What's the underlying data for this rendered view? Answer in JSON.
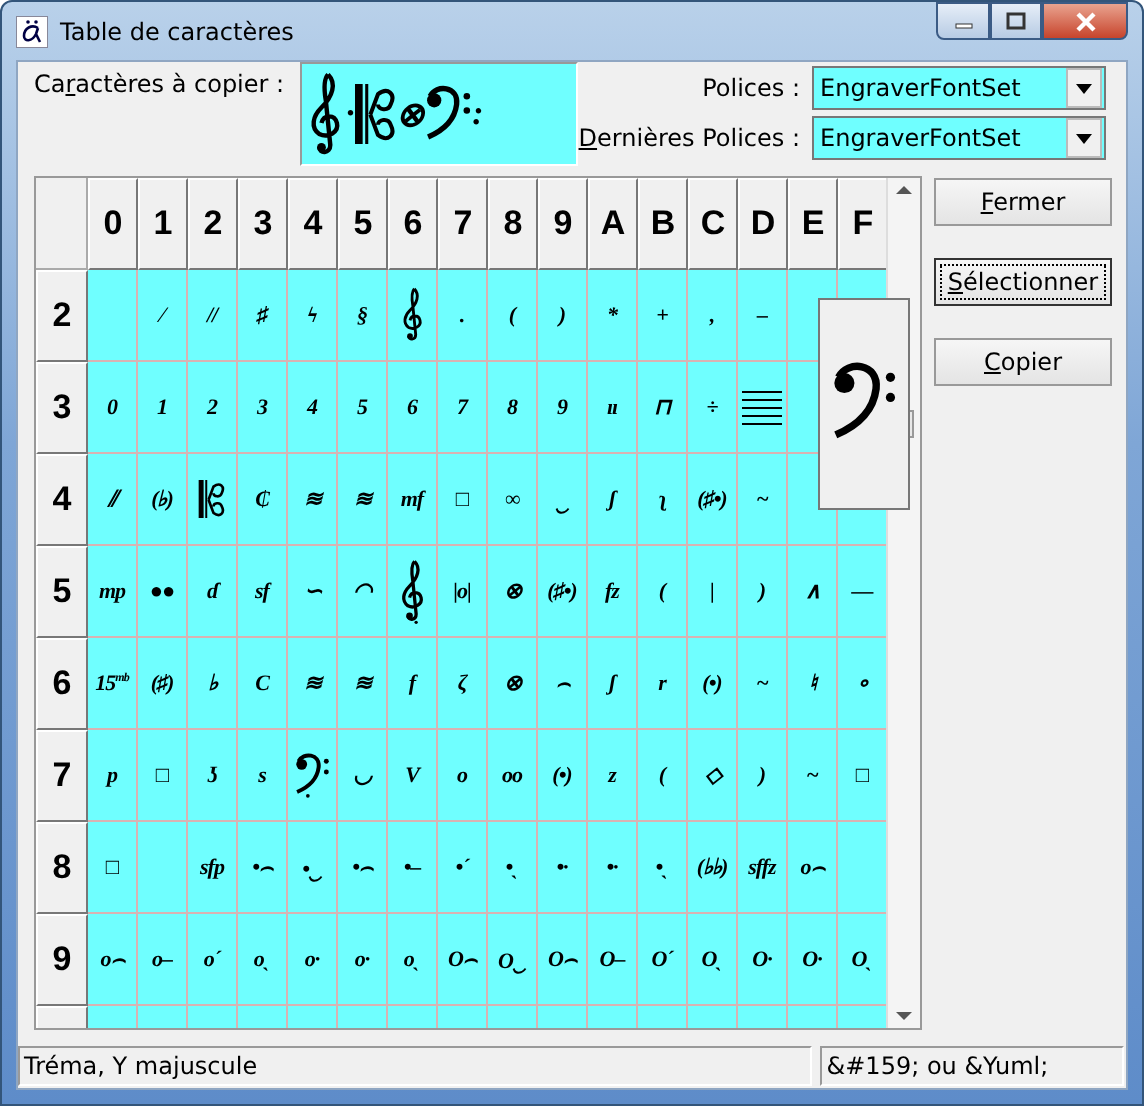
{
  "window": {
    "title": "Table de caractères"
  },
  "copy": {
    "label": {
      "before": "Ca",
      "key": "r",
      "after": "actères à copier :"
    },
    "items": [
      {
        "kind": "treble-clef"
      },
      {
        "kind": "text",
        "text": "·"
      },
      {
        "kind": "alto-clef"
      },
      {
        "kind": "text",
        "text": "⊗"
      },
      {
        "kind": "bass-clef"
      },
      {
        "kind": "text",
        "text": ":"
      }
    ]
  },
  "fonts": [
    {
      "label": {
        "before": "Polices :"
      },
      "value": "EngraverFontSet"
    },
    {
      "label": {
        "key": "D",
        "after": "ernières Polices :"
      },
      "value": "EngraverFontSet"
    }
  ],
  "table": {
    "columns": [
      "0",
      "1",
      "2",
      "3",
      "4",
      "5",
      "6",
      "7",
      "8",
      "9",
      "A",
      "B",
      "C",
      "D",
      "E",
      "F"
    ],
    "rows": [
      {
        "label": "2",
        "cells": [
          {
            "kind": "empty"
          },
          {
            "kind": "text",
            "text": "⁄"
          },
          {
            "kind": "text",
            "text": "//"
          },
          {
            "kind": "text",
            "text": "♯"
          },
          {
            "kind": "text",
            "text": "ϟ"
          },
          {
            "kind": "text",
            "text": "§"
          },
          {
            "kind": "treble-clef"
          },
          {
            "kind": "text",
            "text": "."
          },
          {
            "kind": "text",
            "text": "("
          },
          {
            "kind": "text",
            "text": ")"
          },
          {
            "kind": "text",
            "text": "*"
          },
          {
            "kind": "text",
            "text": "+"
          },
          {
            "kind": "text",
            "text": ","
          },
          {
            "kind": "text",
            "text": "–"
          },
          {
            "kind": "empty"
          },
          {
            "kind": "empty"
          }
        ]
      },
      {
        "label": "3",
        "cells": [
          {
            "kind": "text",
            "text": "0"
          },
          {
            "kind": "text",
            "text": "1"
          },
          {
            "kind": "text",
            "text": "2"
          },
          {
            "kind": "text",
            "text": "3"
          },
          {
            "kind": "text",
            "text": "4"
          },
          {
            "kind": "text",
            "text": "5"
          },
          {
            "kind": "text",
            "text": "6"
          },
          {
            "kind": "text",
            "text": "7"
          },
          {
            "kind": "text",
            "text": "8"
          },
          {
            "kind": "text",
            "text": "9"
          },
          {
            "kind": "text",
            "text": "ıı"
          },
          {
            "kind": "text",
            "text": "⊓"
          },
          {
            "kind": "text",
            "text": "÷"
          },
          {
            "kind": "staff"
          },
          {
            "kind": "empty"
          },
          {
            "kind": "covered"
          }
        ]
      },
      {
        "label": "4",
        "cells": [
          {
            "kind": "text",
            "text": "⫽"
          },
          {
            "kind": "text",
            "text": "(♭)"
          },
          {
            "kind": "alto-clef"
          },
          {
            "kind": "text",
            "text": "₵"
          },
          {
            "kind": "text",
            "text": "≋"
          },
          {
            "kind": "text",
            "text": "≋"
          },
          {
            "kind": "text",
            "text": "mf"
          },
          {
            "kind": "text",
            "text": "□"
          },
          {
            "kind": "text",
            "text": "∞"
          },
          {
            "kind": "text",
            "text": "‿"
          },
          {
            "kind": "text",
            "text": "ʃ"
          },
          {
            "kind": "text",
            "text": "ʅ"
          },
          {
            "kind": "text",
            "text": "(♯•)"
          },
          {
            "kind": "text",
            "text": "~"
          },
          {
            "kind": "empty"
          },
          {
            "kind": "empty"
          }
        ]
      },
      {
        "label": "5",
        "cells": [
          {
            "kind": "text",
            "text": "mp"
          },
          {
            "kind": "text",
            "text": "●●"
          },
          {
            "kind": "text",
            "text": "ɗ"
          },
          {
            "kind": "text",
            "text": "sf"
          },
          {
            "kind": "text",
            "text": "∽"
          },
          {
            "kind": "text",
            "text": "◠"
          },
          {
            "kind": "treble-clef-8"
          },
          {
            "kind": "text",
            "text": "|o|"
          },
          {
            "kind": "text",
            "text": "⊗"
          },
          {
            "kind": "text",
            "text": "(♯•)"
          },
          {
            "kind": "text",
            "text": "fz"
          },
          {
            "kind": "text",
            "text": "("
          },
          {
            "kind": "text",
            "text": "|"
          },
          {
            "kind": "text",
            "text": ")"
          },
          {
            "kind": "text",
            "text": "∧"
          },
          {
            "kind": "text",
            "text": "—"
          }
        ]
      },
      {
        "label": "6",
        "cells": [
          {
            "kind": "text",
            "text": "15$^{mb}$"
          },
          {
            "kind": "text",
            "text": "(♯)"
          },
          {
            "kind": "text",
            "text": "♭"
          },
          {
            "kind": "text",
            "text": "C"
          },
          {
            "kind": "text",
            "text": "≋"
          },
          {
            "kind": "text",
            "text": "≋"
          },
          {
            "kind": "text",
            "text": "f"
          },
          {
            "kind": "text",
            "text": "ζ"
          },
          {
            "kind": "text",
            "text": "⊗"
          },
          {
            "kind": "text",
            "text": "⌢"
          },
          {
            "kind": "text",
            "text": "ʃ"
          },
          {
            "kind": "text",
            "text": "r"
          },
          {
            "kind": "text",
            "text": "(•)"
          },
          {
            "kind": "text",
            "text": "~"
          },
          {
            "kind": "text",
            "text": "♮"
          },
          {
            "kind": "text",
            "text": "∘"
          }
        ]
      },
      {
        "label": "7",
        "cells": [
          {
            "kind": "text",
            "text": "p"
          },
          {
            "kind": "text",
            "text": "□"
          },
          {
            "kind": "text",
            "text": "ʖ"
          },
          {
            "kind": "text",
            "text": "s"
          },
          {
            "kind": "bass-clef-8"
          },
          {
            "kind": "text",
            "text": "◡"
          },
          {
            "kind": "text",
            "text": "V"
          },
          {
            "kind": "text",
            "text": "o"
          },
          {
            "kind": "text",
            "text": "oo"
          },
          {
            "kind": "text",
            "text": "(•)"
          },
          {
            "kind": "text",
            "text": "z"
          },
          {
            "kind": "text",
            "text": "("
          },
          {
            "kind": "text",
            "text": "◇"
          },
          {
            "kind": "text",
            "text": ")"
          },
          {
            "kind": "text",
            "text": "~"
          },
          {
            "kind": "text",
            "text": "□"
          }
        ]
      },
      {
        "label": "8",
        "cells": [
          {
            "kind": "text",
            "text": "□"
          },
          {
            "kind": "empty"
          },
          {
            "kind": "text",
            "text": "sfp"
          },
          {
            "kind": "text",
            "text": "•⌢"
          },
          {
            "kind": "text",
            "text": "•‿"
          },
          {
            "kind": "text",
            "text": "•⌢"
          },
          {
            "kind": "text",
            "text": "•–"
          },
          {
            "kind": "text",
            "text": "•´"
          },
          {
            "kind": "text",
            "text": "•ˎ"
          },
          {
            "kind": "text",
            "text": "•·"
          },
          {
            "kind": "text",
            "text": "•·"
          },
          {
            "kind": "text",
            "text": "•ˎ"
          },
          {
            "kind": "text",
            "text": "(♭♭)"
          },
          {
            "kind": "text",
            "text": "sffz"
          },
          {
            "kind": "text",
            "text": "o⌢"
          },
          {
            "kind": "empty"
          }
        ]
      },
      {
        "label": "9",
        "cells": [
          {
            "kind": "text",
            "text": "o⌢"
          },
          {
            "kind": "text",
            "text": "o–"
          },
          {
            "kind": "text",
            "text": "o´"
          },
          {
            "kind": "text",
            "text": "oˎ"
          },
          {
            "kind": "text",
            "text": "o·"
          },
          {
            "kind": "text",
            "text": "o·"
          },
          {
            "kind": "text",
            "text": "oˎ"
          },
          {
            "kind": "text",
            "text": "O⌢"
          },
          {
            "kind": "text",
            "text": "O‿"
          },
          {
            "kind": "text",
            "text": "O⌢"
          },
          {
            "kind": "text",
            "text": "O–"
          },
          {
            "kind": "text",
            "text": "O´"
          },
          {
            "kind": "text",
            "text": "Oˎ"
          },
          {
            "kind": "text",
            "text": "O·"
          },
          {
            "kind": "text",
            "text": "O·"
          },
          {
            "kind": "text",
            "text": "Oˎ"
          }
        ]
      }
    ]
  },
  "preview": {
    "kind": "bass-clef"
  },
  "buttons": [
    {
      "label": {
        "key": "F",
        "after": "ermer"
      },
      "focused": false
    },
    {
      "label": {
        "key": "S",
        "after": "électionner"
      },
      "focused": true
    },
    {
      "label": {
        "key": "C",
        "after": "opier"
      },
      "focused": false
    }
  ],
  "status_bar": [
    "Tréma, Y majuscule",
    "&#159; ou &Yuml;"
  ]
}
